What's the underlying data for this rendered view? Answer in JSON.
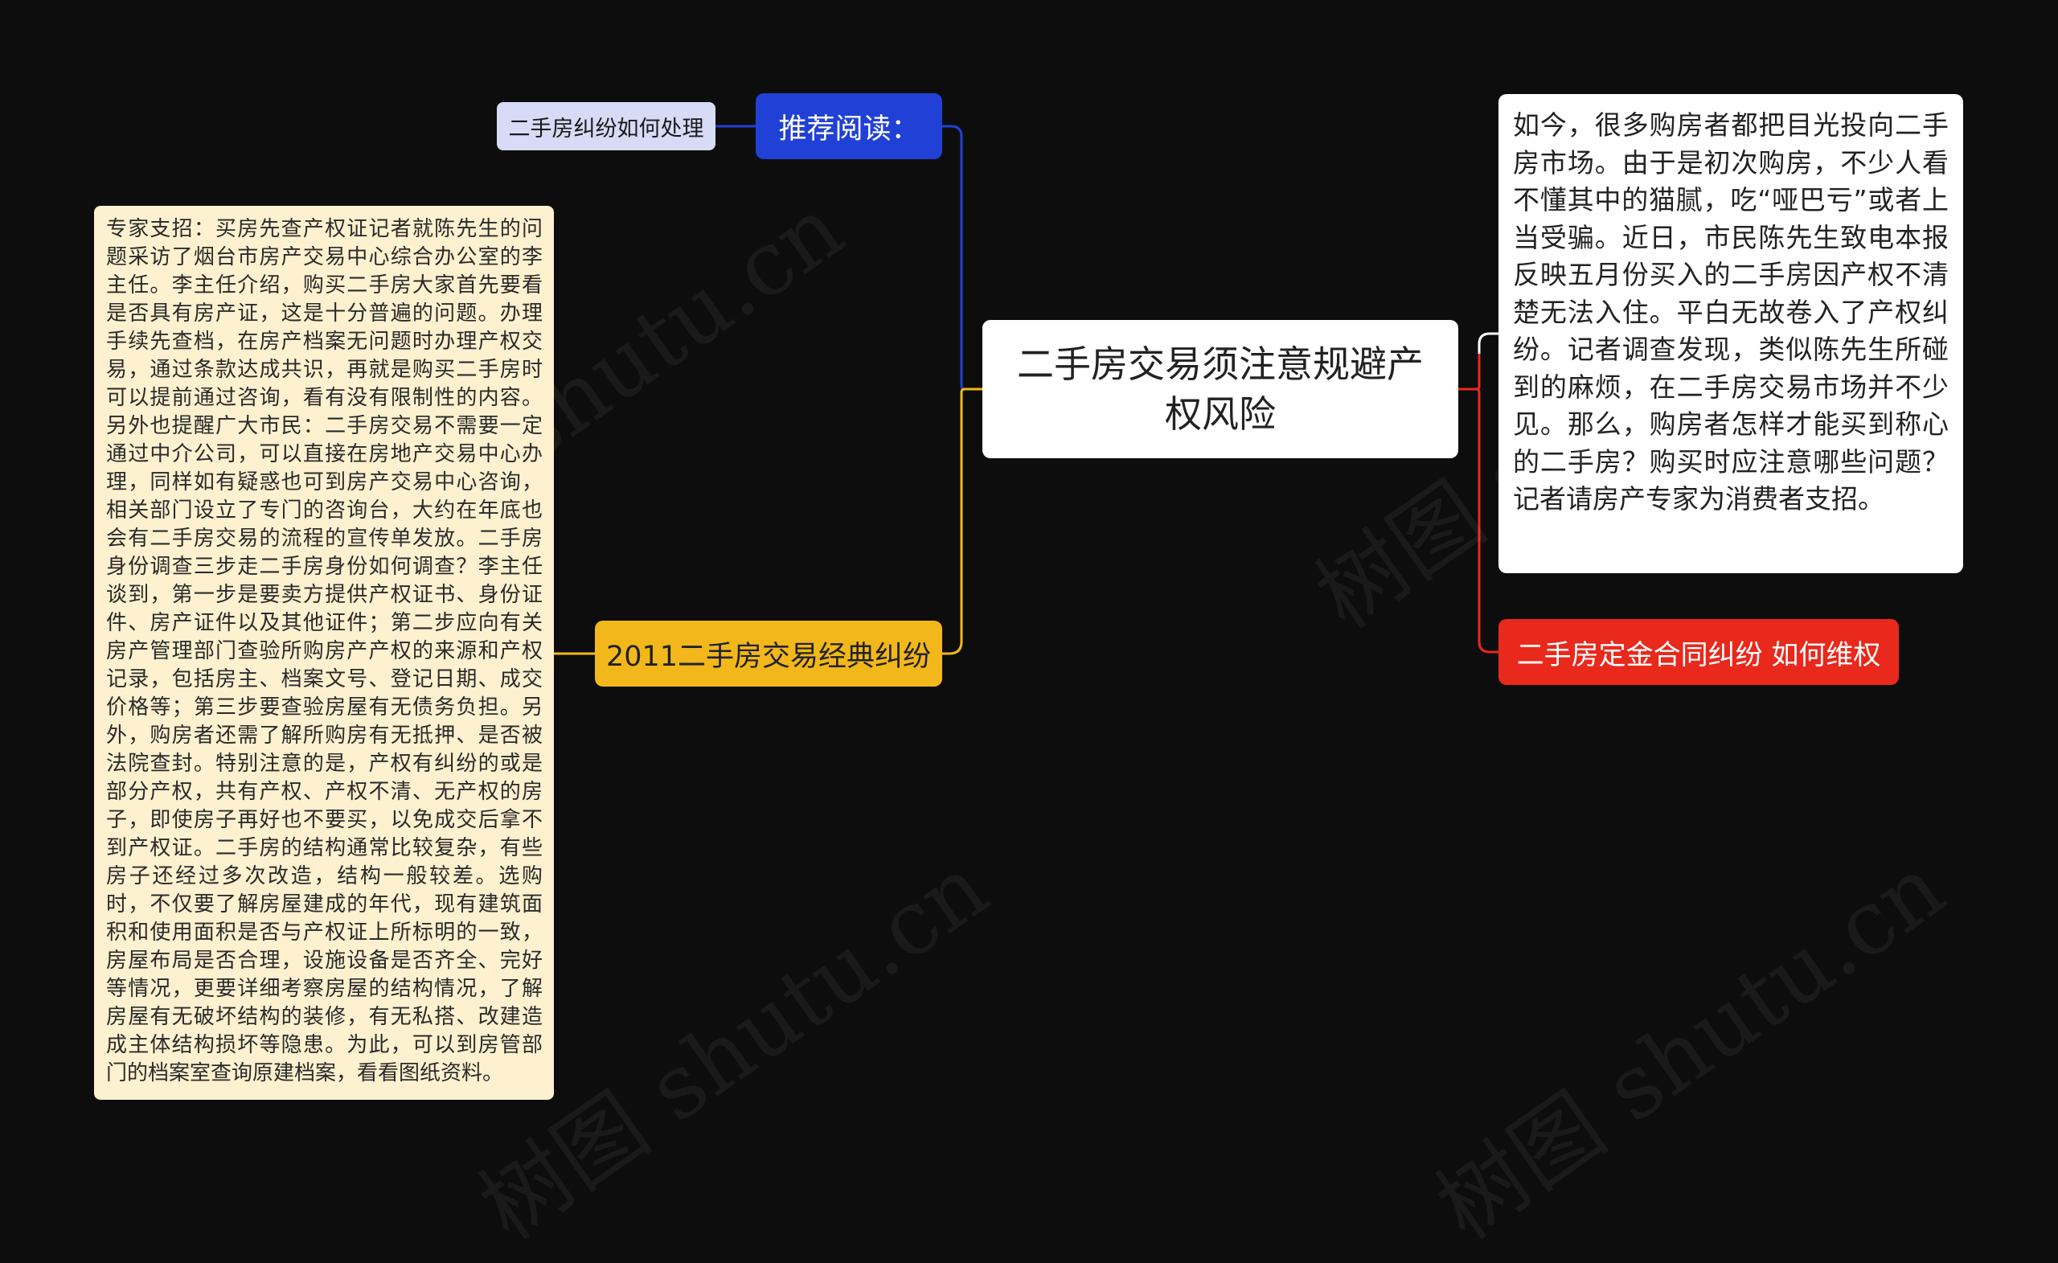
{
  "root": {
    "title": "二手房交易须注意规避产权风险"
  },
  "recommend": {
    "label": "推荐阅读：",
    "items": [
      "二手房纠纷如何处理"
    ]
  },
  "classic": {
    "label": "2011二手房交易经典纠纷",
    "detail": "专家支招：买房先查产权证记者就陈先生的问题采访了烟台市房产交易中心综合办公室的李主任。李主任介绍，购买二手房大家首先要看是否具有房产证，这是十分普遍的问题。办理手续先查档，在房产档案无问题时办理产权交易，通过条款达成共识，再就是购买二手房时可以提前通过咨询，看有没有限制性的内容。另外也提醒广大市民：二手房交易不需要一定通过中介公司，可以直接在房地产交易中心办理，同样如有疑惑也可到房产交易中心咨询，相关部门设立了专门的咨询台，大约在年底也会有二手房交易的流程的宣传单发放。二手房身份调查三步走二手房身份如何调查？李主任谈到，第一步是要卖方提供产权证书、身份证件、房产证件以及其他证件；第二步应向有关房产管理部门查验所购房产产权的来源和产权记录，包括房主、档案文号、登记日期、成交价格等；第三步要查验房屋有无债务负担。另外，购房者还需了解所购房有无抵押、是否被法院查封。特别注意的是，产权有纠纷的或是部分产权，共有产权、产权不清、无产权的房子，即使房子再好也不要买，以免成交后拿不到产权证。二手房的结构通常比较复杂，有些房子还经过多次改造，结构一般较差。选购时，不仅要了解房屋建成的年代，现有建筑面积和使用面积是否与产权证上所标明的一致，房屋布局是否合理，设施设备是否齐全、完好等情况，更要详细考察房屋的结构情况，了解房屋有无破坏结构的装修，有无私搭、改建造成主体结构损坏等隐患。为此，可以到房管部门的档案室查询原建档案，看看图纸资料。"
  },
  "intro": {
    "text": "如今，很多购房者都把目光投向二手房市场。由于是初次购房，不少人看不懂其中的猫腻，吃“哑巴亏”或者上当受骗。近日，市民陈先生致电本报反映五月份买入的二手房因产权不清楚无法入住。平白无故卷入了产权纠纷。记者调查发现，类似陈先生所碰到的麻烦，在二手房交易市场并不少见。那么，购房者怎样才能买到称心的二手房？购买时应注意哪些问题？记者请房产专家为消费者支招。"
  },
  "deposit": {
    "label": "二手房定金合同纠纷 如何维权"
  },
  "watermark": {
    "text": "树图 shutu.cn"
  },
  "colors": {
    "background": "#0d0d0d",
    "blue": "#2141d6",
    "yellow": "#f2b81b",
    "red": "#e8291c",
    "white": "#ffffff"
  }
}
